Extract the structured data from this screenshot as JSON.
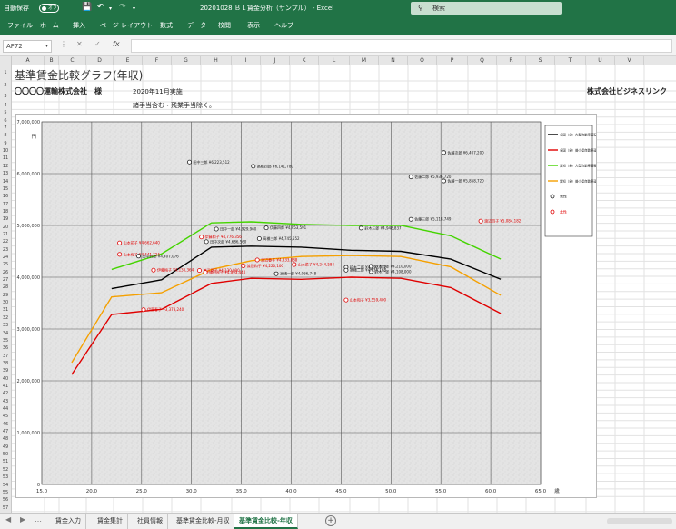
{
  "titlebar": {
    "autosave_label": "自動保存",
    "autosave_state": "オフ",
    "doc_title": "20201028 ＢＬ賃金分析（サンプル） - Excel",
    "search_placeholder": "検索"
  },
  "menu": [
    "ファイル",
    "ホーム",
    "挿入",
    "ページ レイアウト",
    "数式",
    "データ",
    "校閲",
    "表示",
    "ヘルプ"
  ],
  "namebox": "AF72",
  "columns": [
    "A",
    "B",
    "C",
    "D",
    "E",
    "F",
    "G",
    "H",
    "I",
    "J",
    "K",
    "L",
    "M",
    "N",
    "O",
    "P",
    "Q",
    "R",
    "S",
    "T",
    "U",
    "V"
  ],
  "rows": [
    "1",
    "2",
    "3",
    "4",
    "5",
    "6",
    "7",
    "8",
    "9",
    "10",
    "11",
    "12",
    "13",
    "14",
    "15",
    "16",
    "17",
    "18",
    "19",
    "20",
    "21",
    "22",
    "23",
    "24",
    "25",
    "26",
    "27",
    "28",
    "29",
    "30",
    "31",
    "32",
    "33",
    "34",
    "35",
    "36",
    "37",
    "38",
    "39",
    "40",
    "41",
    "42",
    "43",
    "44",
    "45",
    "46",
    "47",
    "48",
    "49",
    "50",
    "51",
    "52",
    "53",
    "54",
    "55",
    "56",
    "57",
    "58",
    "59"
  ],
  "sheet": {
    "title": "基準賃金比較グラフ(年収)",
    "company_left": "〇〇〇〇運輸株式会社　様",
    "date_note": "2020年11月実施",
    "company_right": "株式会社ビジネスリンク",
    "allowance_note": "諸手当含む・残業手当除く。"
  },
  "chart_data": {
    "type": "line",
    "y_unit": "円",
    "x_unit": "歳",
    "xlim": [
      15,
      65
    ],
    "ylim": [
      0,
      7000000
    ],
    "x_ticks": [
      "15.0",
      "20.0",
      "25.0",
      "30.0",
      "35.0",
      "40.0",
      "45.0",
      "50.0",
      "55.0",
      "60.0",
      "65.0"
    ],
    "y_ticks": [
      "0",
      "1,000,000",
      "2,000,000",
      "3,000,000",
      "4,000,000",
      "5,000,000",
      "6,000,000",
      "7,000,000"
    ],
    "grid": true,
    "legend_position": "right",
    "series": [
      {
        "name": "全国（全）大型自動車運転者(男)10～99人",
        "color": "#000000",
        "x": [
          22,
          27,
          32,
          36,
          41,
          46,
          51,
          56,
          61
        ],
        "y": [
          3780000,
          3950000,
          4580000,
          4600000,
          4580000,
          4520000,
          4500000,
          4350000,
          3960000
        ]
      },
      {
        "name": "全国（全）普小型自動車運転者(男)10～99人",
        "color": "#e00000",
        "x": [
          18,
          22,
          27,
          32,
          36,
          41,
          46,
          51,
          56,
          61
        ],
        "y": [
          2120000,
          3280000,
          3380000,
          3880000,
          3980000,
          3960000,
          4000000,
          3980000,
          3800000,
          3300000
        ]
      },
      {
        "name": "愛知（全）大型自動車運転者(男)10～99人",
        "color": "#44d400",
        "x": [
          22,
          27,
          32,
          36,
          41,
          46,
          51,
          56,
          61
        ],
        "y": [
          4150000,
          4450000,
          5050000,
          5070000,
          5020000,
          5000000,
          5000000,
          4800000,
          4350000
        ]
      },
      {
        "name": "愛知（全）普小型自動車運転者(男)10～99人",
        "color": "#f5a000",
        "x": [
          18,
          22,
          27,
          32,
          36,
          41,
          46,
          51,
          56,
          61
        ],
        "y": [
          2350000,
          3620000,
          3700000,
          4150000,
          4320000,
          4400000,
          4420000,
          4400000,
          4200000,
          3650000
        ]
      }
    ],
    "male_series_name": "男性",
    "female_series_name": "女性",
    "points": [
      {
        "x": 55.3,
        "y": 6407200,
        "label": "佐藤次郎 ¥6,407,200",
        "sex": "male"
      },
      {
        "x": 29.8,
        "y": 6223512,
        "label": "田中三郎 ¥6,223,512",
        "sex": "male"
      },
      {
        "x": 36.2,
        "y": 6141780,
        "label": "高橋四郎 ¥6,141,780",
        "sex": "male"
      },
      {
        "x": 52.0,
        "y": 5936720,
        "label": "佐藤二郎 ¥5,936,720",
        "sex": "male"
      },
      {
        "x": 55.3,
        "y": 5858720,
        "label": "佐藤一郎 ¥5,858,720",
        "sex": "male"
      },
      {
        "x": 52.0,
        "y": 5118749,
        "label": "佐藤三郎 ¥5,118,749",
        "sex": "male"
      },
      {
        "x": 59.0,
        "y": 5084182,
        "label": "渡辺四子 ¥5,084,182",
        "sex": "female"
      },
      {
        "x": 37.5,
        "y": 4953591,
        "label": "伊藤四郎 ¥4,953,591",
        "sex": "male"
      },
      {
        "x": 47.0,
        "y": 4948837,
        "label": "鈴木三郎 ¥4,948,837",
        "sex": "male"
      },
      {
        "x": 32.5,
        "y": 4929960,
        "label": "田中一郎 ¥4,929,960",
        "sex": "male"
      },
      {
        "x": 31.0,
        "y": 4776356,
        "label": "伊藤和子 ¥4,776,356",
        "sex": "female"
      },
      {
        "x": 36.8,
        "y": 4745552,
        "label": "高橋三郎 ¥4,745,552",
        "sex": "male"
      },
      {
        "x": 31.5,
        "y": 4686560,
        "label": "田中次郎 ¥4,686,560",
        "sex": "male"
      },
      {
        "x": 22.8,
        "y": 4662640,
        "label": "山本花子 ¥4,662,640",
        "sex": "female"
      },
      {
        "x": 22.8,
        "y": 4441724,
        "label": "山本梅子 ¥4,441,724",
        "sex": "female"
      },
      {
        "x": 24.7,
        "y": 4407076,
        "label": "田中四郎 ¥4,407,076",
        "sex": "male"
      },
      {
        "x": 36.6,
        "y": 4333888,
        "label": "渡辺春子 ¥4,333,888",
        "sex": "female"
      },
      {
        "x": 48.0,
        "y": 4210000,
        "label": "鈴木四郎 ¥4,210,000",
        "sex": "male"
      },
      {
        "x": 35.2,
        "y": 4220100,
        "label": "渡辺和子 ¥4,220,100",
        "sex": "female"
      },
      {
        "x": 40.3,
        "y": 4244584,
        "label": "山本菜子 ¥4,244,584",
        "sex": "female"
      },
      {
        "x": 45.5,
        "y": 4192472,
        "label": "鈴木二郎 ¥4,192,472",
        "sex": "male"
      },
      {
        "x": 48.0,
        "y": 4108000,
        "label": "鈴木一郎 ¥4,108,000",
        "sex": "male"
      },
      {
        "x": 30.8,
        "y": 4130000,
        "label": "渡辺夏子 ¥4,130,000",
        "sex": "female"
      },
      {
        "x": 26.2,
        "y": 4136364,
        "label": "伊藤梅子 ¥4,136,364",
        "sex": "female"
      },
      {
        "x": 31.4,
        "y": 4093440,
        "label": "渡辺秋子 ¥4,093,440",
        "sex": "female"
      },
      {
        "x": 38.5,
        "y": 4066748,
        "label": "高橋一郎 ¥4,066,748",
        "sex": "male"
      },
      {
        "x": 45.5,
        "y": 4136168,
        "label": "高橋二郎 ¥4,136,168",
        "sex": "male"
      },
      {
        "x": 45.5,
        "y": 3559400,
        "label": "山本和子 ¥3,559,400",
        "sex": "female"
      },
      {
        "x": 25.2,
        "y": 3373240,
        "label": "伊藤春子 ¥3,373,240",
        "sex": "female"
      }
    ]
  },
  "tabs": [
    "賃金入力",
    "賃金集計",
    "社員情報",
    "基準賃金比較-月収",
    "基準賃金比較-年収"
  ],
  "active_tab": "基準賃金比較-年収"
}
